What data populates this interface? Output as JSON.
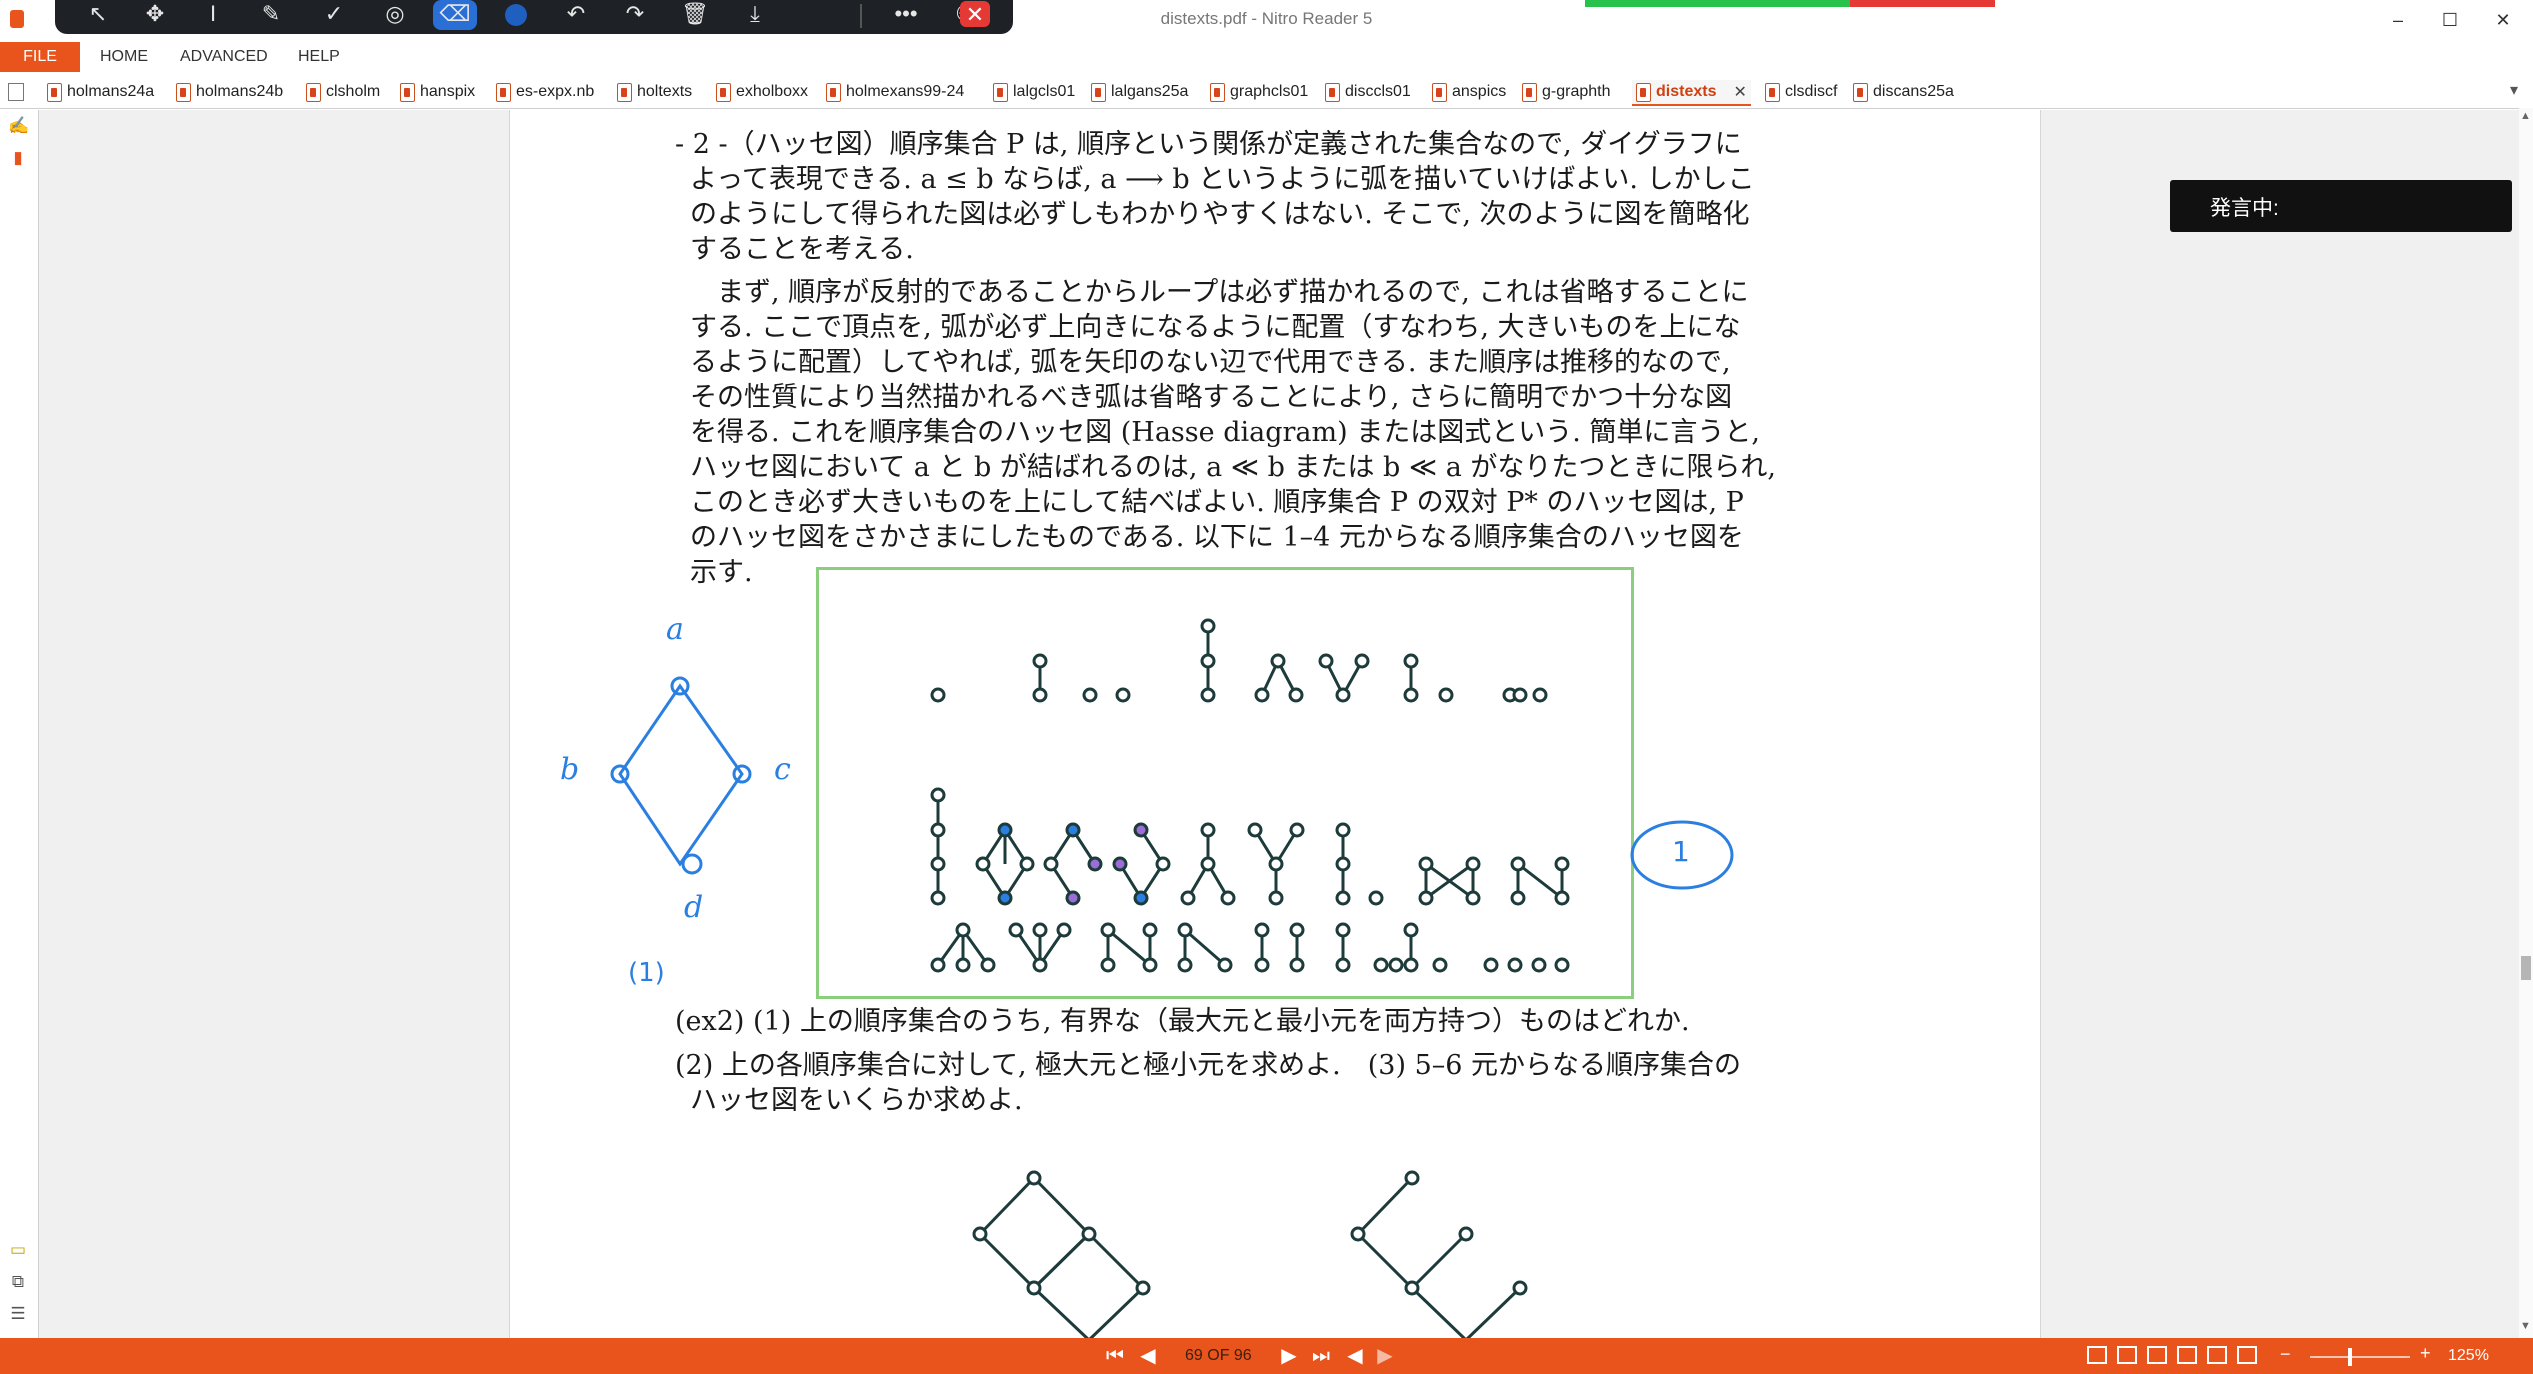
{
  "window": {
    "title": "distexts.pdf - Nitro Reader 5",
    "minimize_icon": "minimize-icon",
    "maximize_icon": "maximize-icon",
    "close_icon": "close-icon"
  },
  "draw_toolbar": {
    "tools": [
      "select-arrow-icon",
      "move-icon",
      "text-cursor-icon",
      "pen-icon",
      "check-icon",
      "target-icon",
      "eraser-icon",
      "color-swatch",
      "undo-icon",
      "redo-icon",
      "trash-icon",
      "download-icon",
      "more-icon",
      "participants-icon",
      "close-icon"
    ],
    "active_tool": "eraser",
    "active_color": "#2a6fd6"
  },
  "menu": {
    "file": "FILE",
    "items": [
      "HOME",
      "ADVANCED",
      "HELP"
    ]
  },
  "tabs": [
    "holmans24a",
    "holmans24b",
    "clsholm",
    "hanspix",
    "es-expx.nb",
    "holtexts",
    "exholboxx",
    "holmexans99-24",
    "lalgcls01",
    "lalgans25a",
    "graphcls01",
    "disccls01",
    "anspics",
    "g-graphth",
    "distexts",
    "clsdiscf",
    "discans25a"
  ],
  "active_tab": "distexts",
  "document": {
    "p1_line1": "- 2 -（ハッセ図）順序集合 P は, 順序という関係が定義された集合なので, ダイグラフに",
    "p1_line2": "よって表現できる. a ≤ b ならば, a ⟶ b というように弧を描いていけばよい. しかしこ",
    "p1_line3": "のようにして得られた図は必ずしもわかりやすくはない. そこで, 次のように図を簡略化",
    "p1_line4": "することを考える.",
    "p2_line1": "　まず, 順序が反射的であることからループは必ず描かれるので, これは省略することに",
    "p2_line2": "する. ここで頂点を, 弧が必ず上向きになるように配置（すなわち, 大きいものを上にな",
    "p2_line3": "るように配置）してやれば, 弧を矢印のない辺で代用できる. また順序は推移的なので,",
    "p2_line4": "その性質により当然描かれるべき弧は省略することにより, さらに簡明でかつ十分な図",
    "p2_line5": "を得る. これを順序集合のハッセ図 (Hasse diagram) または図式という. 簡単に言うと,",
    "p2_line6": "ハッセ図において a と b が結ばれるのは, a ≪ b または b ≪ a がなりたつときに限られ,",
    "p2_line7": "このとき必ず大きいものを上にして結べばよい. 順序集合 P の双対 P* のハッセ図は, P",
    "p2_line8": "のハッセ図をさかさまにしたものである. 以下に 1–4 元からなる順序集合のハッセ図を",
    "p2_line9": "示す.",
    "ex2_line1": "(ex2) (1) 上の順序集合のうち, 有界な（最大元と最小元を両方持つ）ものはどれか.",
    "ex2_line2": "(2) 上の各順序集合に対して, 極大元と極小元を求めよ.　(3) 5–6 元からなる順序集合の",
    "ex2_line3": "ハッセ図をいくらか求めよ."
  },
  "annotations": {
    "label_top": "a",
    "label_left": "b",
    "label_right": "c",
    "label_bottom": "d",
    "label_caption": "(1)",
    "circled_number": "1"
  },
  "speaking": {
    "label": "発言中:"
  },
  "status": {
    "page_counter": "69 OF 96",
    "zoom": "125%"
  },
  "colors": {
    "accent": "#e8541c",
    "ink_blue": "#2a7fe0",
    "highlight_purple": "#9b6dd6",
    "frame_green": "#8bcf7e"
  }
}
